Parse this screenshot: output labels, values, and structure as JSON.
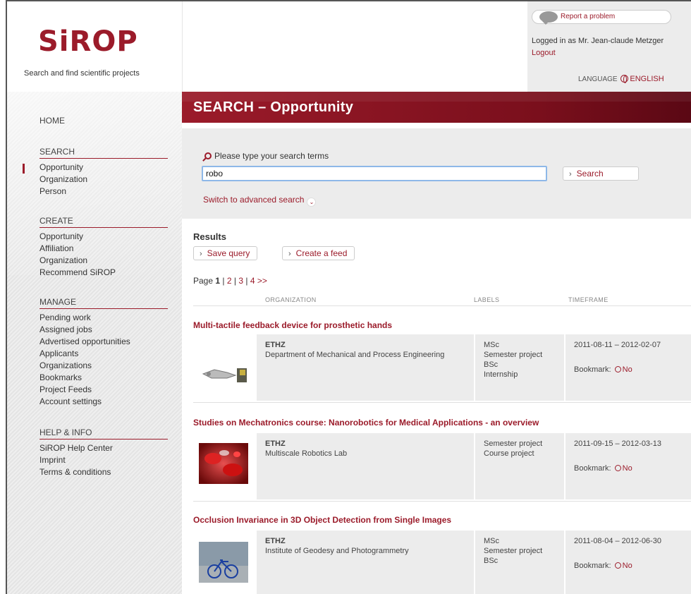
{
  "brand": {
    "logo": "SiROP",
    "tagline": "Search and find scientific projects"
  },
  "user": {
    "report_label": "Report a problem",
    "logged_in": "Logged in as Mr. Jean-claude Metzger",
    "logout": "Logout",
    "language_label": "LANGUAGE",
    "language_value": "ENGLISH"
  },
  "sidebar": {
    "home": "HOME",
    "sections": [
      {
        "title": "SEARCH",
        "items": [
          "Opportunity",
          "Organization",
          "Person"
        ]
      },
      {
        "title": "CREATE",
        "items": [
          "Opportunity",
          "Affiliation",
          "Organization",
          "Recommend SiROP"
        ]
      },
      {
        "title": "MANAGE",
        "items": [
          "Pending work",
          "Assigned jobs",
          "Advertised opportunities",
          "Applicants",
          "Organizations",
          "Bookmarks",
          "Project Feeds",
          "Account settings"
        ]
      },
      {
        "title": "HELP & INFO",
        "items": [
          "SiROP Help Center",
          "Imprint",
          "Terms & conditions"
        ]
      }
    ]
  },
  "page": {
    "title": "SEARCH – Opportunity"
  },
  "search": {
    "label": "Please type your search terms",
    "value": "robo",
    "button": "Search",
    "advanced": "Switch to advanced search"
  },
  "results": {
    "title": "Results",
    "save_query": "Save query",
    "create_feed": "Create a feed",
    "pager_prefix": "Page",
    "pager_current": "1",
    "pager_sep": "|",
    "pager_pages": [
      "2",
      "3",
      "4"
    ],
    "pager_next": ">>",
    "col_organization": "ORGANIZATION",
    "col_labels": "LABELS",
    "col_timeframe": "TIMEFRAME",
    "bookmark_label": "Bookmark:",
    "bookmark_value": "No",
    "items": [
      {
        "title": "Multi-tactile feedback device for prosthetic hands",
        "org": "ETHZ",
        "dept": "Department of Mechanical and Process Engineering",
        "labels": [
          "MSc",
          "Semester project",
          "BSc",
          "Internship"
        ],
        "timeframe": "2011-08-11 – 2012-02-07"
      },
      {
        "title": "Studies on Mechatronics course: Nanorobotics for Medical Applications - an overview",
        "org": "ETHZ",
        "dept": "Multiscale Robotics Lab",
        "labels": [
          "Semester project",
          "Course project"
        ],
        "timeframe": "2011-09-15 – 2012-03-13"
      },
      {
        "title": "Occlusion Invariance in 3D Object Detection from Single Images",
        "org": "ETHZ",
        "dept": "Institute of Geodesy and Photogrammetry",
        "labels": [
          "MSc",
          "Semester project",
          "BSc"
        ],
        "timeframe": "2011-08-04 – 2012-06-30"
      }
    ]
  },
  "colors": {
    "brand": "#9b1b2a",
    "panel": "#ececec",
    "focus": "#8eb8e8"
  }
}
